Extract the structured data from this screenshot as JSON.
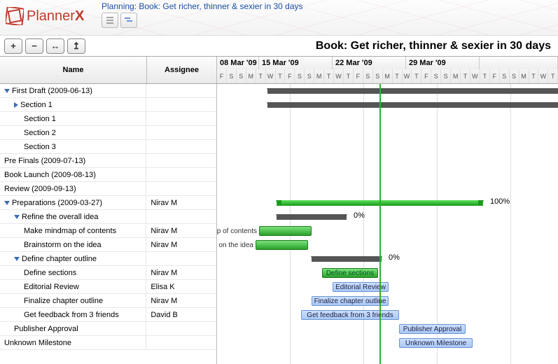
{
  "header": {
    "app_name_plain": "Planner",
    "app_name_bold": "X",
    "title_prefix": "Planning: ",
    "book_title": "Book: Get richer, thinner & sexier in 30 days"
  },
  "toolbar": {
    "zoom_in": "+",
    "zoom_out": "−",
    "fit": "↔",
    "collapse": "↥"
  },
  "project_title": "Book: Get richer, thinner & sexier in 30 days",
  "columns": {
    "name": "Name",
    "assignee": "Assignee"
  },
  "timeline": {
    "weeks": [
      "08 Mar '09",
      "15 Mar '09",
      "22 Mar '09",
      "29 Mar '09"
    ],
    "day_initials": [
      "M",
      "T",
      "W",
      "T",
      "F",
      "S",
      "S"
    ]
  },
  "tasks": [
    {
      "name": "First Draft (2009-06-13)",
      "assignee": "",
      "indent": 1,
      "expander": "down"
    },
    {
      "name": "Section 1",
      "assignee": "",
      "indent": 2,
      "expander": "right"
    },
    {
      "name": "Section 1",
      "assignee": "",
      "indent": 3
    },
    {
      "name": "Section 2",
      "assignee": "",
      "indent": 3
    },
    {
      "name": "Section 3",
      "assignee": "",
      "indent": 3
    },
    {
      "name": "Pre Finals (2009-07-13)",
      "assignee": "",
      "indent": 1
    },
    {
      "name": "Book Launch (2009-08-13)",
      "assignee": "",
      "indent": 1
    },
    {
      "name": "Review (2009-09-13)",
      "assignee": "",
      "indent": 1
    },
    {
      "name": "Preparations (2009-03-27)",
      "assignee": "Nirav M",
      "indent": 1,
      "expander": "down"
    },
    {
      "name": "Refine the overall idea",
      "assignee": "",
      "indent": 2,
      "expander": "down"
    },
    {
      "name": "Make mindmap of contents",
      "assignee": "Nirav M",
      "indent": 3
    },
    {
      "name": "Brainstorm on the idea",
      "assignee": "Nirav M",
      "indent": 3
    },
    {
      "name": "Define chapter outline",
      "assignee": "",
      "indent": 2,
      "expander": "down"
    },
    {
      "name": "Define sections",
      "assignee": "Nirav M",
      "indent": 3
    },
    {
      "name": "Editorial Review",
      "assignee": "Elisa K",
      "indent": 3
    },
    {
      "name": "Finalize chapter outline",
      "assignee": "Nirav M",
      "indent": 3
    },
    {
      "name": "Get feedback from 3 friends",
      "assignee": "David B",
      "indent": 3
    },
    {
      "name": "Publisher Approval",
      "assignee": "",
      "indent": 2
    },
    {
      "name": "Unknown Milestone",
      "assignee": "",
      "indent": 1
    }
  ],
  "percents": {
    "p0": "0%",
    "p100": "100%"
  },
  "bar_labels": {
    "mindmap": "Make mindmap of contents",
    "brainstorm": "Brainstorm on the idea",
    "define_sections": "Define sections",
    "editorial": "Editorial Review",
    "finalize": "Finalize chapter outline",
    "feedback": "Get feedback from 3 friends",
    "publisher": "Publisher Approval",
    "unknown": "Unknown Milestone"
  }
}
